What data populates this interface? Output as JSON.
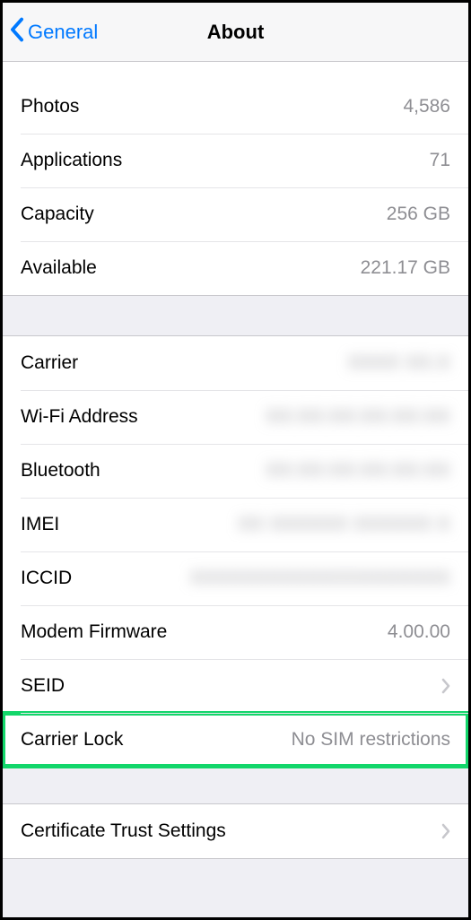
{
  "nav": {
    "back_label": "General",
    "title": "About"
  },
  "group1": [
    {
      "label": "Photos",
      "value": "4,586"
    },
    {
      "label": "Applications",
      "value": "71"
    },
    {
      "label": "Capacity",
      "value": "256 GB"
    },
    {
      "label": "Available",
      "value": "221.17 GB"
    }
  ],
  "group2": [
    {
      "label": "Carrier",
      "value": "XXXX XX.X",
      "blurred": true
    },
    {
      "label": "Wi-Fi Address",
      "value": "XX:XX:XX:XX:XX:XX",
      "blurred": true
    },
    {
      "label": "Bluetooth",
      "value": "XX:XX:XX:XX:XX:XX",
      "blurred": true
    },
    {
      "label": "IMEI",
      "value": "XX XXXXXX XXXXXX X",
      "blurred": true
    },
    {
      "label": "ICCID",
      "value": "XXXXXXXXXXXXXXXXXXXX",
      "blurred": true
    },
    {
      "label": "Modem Firmware",
      "value": "4.00.00"
    },
    {
      "label": "SEID",
      "value": "",
      "disclosure": true
    },
    {
      "label": "Carrier Lock",
      "value": "No SIM restrictions",
      "highlight": true
    }
  ],
  "group3": [
    {
      "label": "Certificate Trust Settings",
      "value": "",
      "disclosure": true
    }
  ]
}
